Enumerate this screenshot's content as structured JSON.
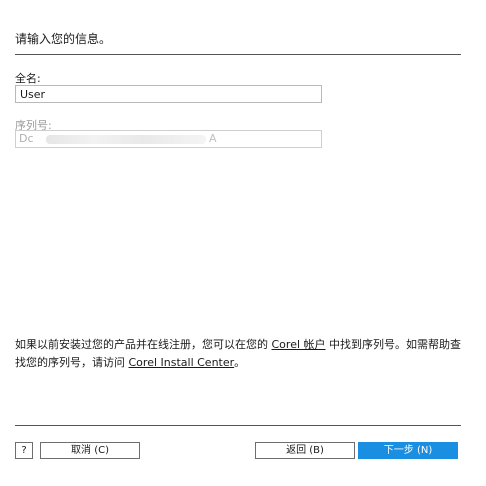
{
  "header": {
    "title": "请输入您的信息。"
  },
  "form": {
    "name_label": "全名:",
    "name_value": "User",
    "serial_label": "序列号:",
    "serial_prefix": "Dc",
    "serial_suffix": "A"
  },
  "info": {
    "text_before_link1": "如果以前安装过您的产品并在线注册，您可以在您的",
    "link1": "Corel 帐户",
    "text_between_links": "中找到序列号。如需帮助查找您的序列号，请访问",
    "link2": "Corel Install Center",
    "text_after_link2": "。"
  },
  "footer": {
    "help_label": "?",
    "cancel_label": "取消 (C)",
    "back_label": "返回 (B)",
    "next_label": "下一步 (N)"
  },
  "colors": {
    "primary_button": "#1a8ee0",
    "disabled_text": "#9a9a9a"
  }
}
